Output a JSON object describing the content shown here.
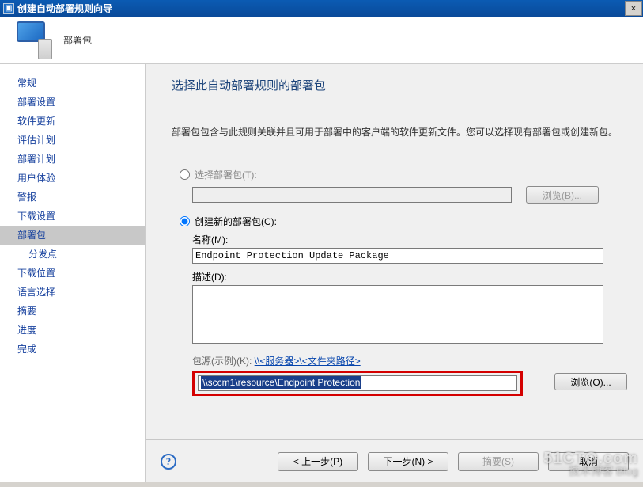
{
  "titlebar": {
    "title": "创建自动部署规则向导",
    "close": "×"
  },
  "header": {
    "label": "部署包"
  },
  "sidebar": {
    "items": [
      {
        "label": "常规"
      },
      {
        "label": "部署设置"
      },
      {
        "label": "软件更新"
      },
      {
        "label": "评估计划"
      },
      {
        "label": "部署计划"
      },
      {
        "label": "用户体验"
      },
      {
        "label": "警报"
      },
      {
        "label": "下载设置"
      },
      {
        "label": "部署包",
        "selected": true
      },
      {
        "label": "分发点",
        "sub": true
      },
      {
        "label": "下载位置"
      },
      {
        "label": "语言选择"
      },
      {
        "label": "摘要"
      },
      {
        "label": "进度"
      },
      {
        "label": "完成"
      }
    ]
  },
  "content": {
    "heading": "选择此自动部署规则的部署包",
    "description": "部署包包含与此规则关联并且可用于部署中的客户端的软件更新文件。您可以选择现有部署包或创建新包。",
    "radio_existing": "选择部署包(T):",
    "browse_disabled": "浏览(B)...",
    "radio_new": "创建新的部署包(C):",
    "name_label": "名称(M):",
    "name_value": "Endpoint Protection Update Package",
    "desc_label": "描述(D):",
    "desc_value": "",
    "src_example_prefix": "包源(示例)(K):",
    "src_example_link": "\\\\<服务器>\\<文件夹路径>",
    "source_value": "\\\\sccm1\\resource\\Endpoint Protection",
    "browse_enabled": "浏览(O)..."
  },
  "buttons": {
    "prev": "< 上一步(P)",
    "next": "下一步(N) >",
    "summary": "摘要(S)",
    "cancel": "取消"
  },
  "watermark": {
    "line1": "51CTO.com",
    "line2": "技术博客   Blog"
  }
}
